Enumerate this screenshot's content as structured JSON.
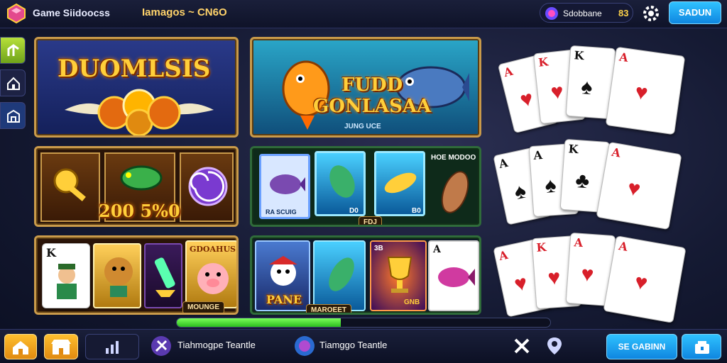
{
  "header": {
    "app_title": "Game Siidoocss",
    "tag": "Iamagos ~ CN6O",
    "coin_label": "Sdobbane",
    "coin_count": "83",
    "top_button": "SADUN"
  },
  "tiles": {
    "featured_1_title": "DUOMLSIS",
    "featured_2_title_line1": "FUDD",
    "featured_2_title_line2": "GONLASAA",
    "featured_2_sub": "JUNG UCE",
    "slots_amount": "200 5%0",
    "fish_grid_caption": "HOE MODOO",
    "fish_card_label_1": "RA SCUIG",
    "fish_card_label_2": "D0",
    "fish_card_label_3": "B0",
    "fish_badge": "FDJ",
    "cards_row_title": "GDOAHUS",
    "cards_row_badge": "MOUNGE",
    "bottom_tile_label": "PANE",
    "bottom_tile_badge": "MAROEET",
    "tile_corner_label": "3B",
    "bottom_tile_text": "GNB"
  },
  "progress": {
    "value": 0.44,
    "color": "#2bbd1f"
  },
  "footer": {
    "item_1": "Tiahmogpe Teantle",
    "item_2": "Tiamggo Teantle",
    "button_right": "SE GABINN"
  },
  "playing_cards": [
    {
      "rank": "A",
      "suit": "♥",
      "color": "red"
    },
    {
      "rank": "K",
      "suit": "♥",
      "color": "red"
    },
    {
      "rank": "K",
      "suit": "♠",
      "color": "black"
    },
    {
      "rank": "A",
      "suit": "♥",
      "color": "red"
    }
  ],
  "colors": {
    "accent": "#ffcf3a",
    "frame": "#c99a4a",
    "button_blue": "#0f86e0"
  }
}
